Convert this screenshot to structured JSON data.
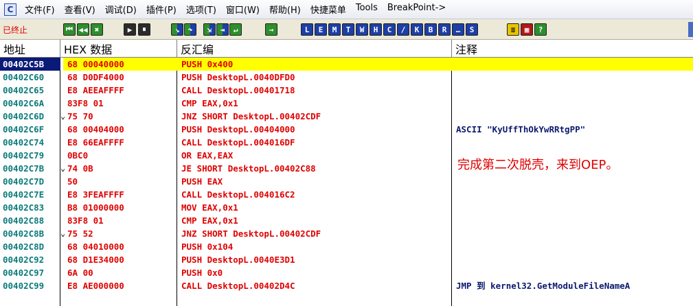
{
  "menu": {
    "app_icon_text": "C",
    "items": [
      "文件(F)",
      "查看(V)",
      "调试(D)",
      "插件(P)",
      "选项(T)",
      "窗口(W)",
      "帮助(H)",
      "快捷菜单",
      "Tools",
      "BreakPoint->"
    ]
  },
  "toolbar": {
    "status": "已终止",
    "status_color": "#e00000",
    "buttons": [
      {
        "label": "⏮",
        "icon": "restart-icon"
      },
      {
        "label": "◀◀",
        "icon": "rewind-icon"
      },
      {
        "label": "✖",
        "icon": "close-icon"
      },
      {
        "label": "▶",
        "icon": "run-icon"
      },
      {
        "label": "⏸",
        "icon": "pause-icon"
      },
      {
        "label": "↘",
        "icon": "step-into-icon"
      },
      {
        "label": "↷",
        "icon": "step-over-icon"
      },
      {
        "label": "⇲",
        "icon": "trace-into-icon"
      },
      {
        "label": "⇥",
        "icon": "trace-over-icon"
      },
      {
        "label": "↵",
        "icon": "execute-till-return-icon"
      },
      {
        "label": "→",
        "icon": "goto-icon"
      },
      {
        "label": "L",
        "icon": "log-window-icon"
      },
      {
        "label": "E",
        "icon": "executable-modules-icon"
      },
      {
        "label": "M",
        "icon": "memory-map-icon"
      },
      {
        "label": "T",
        "icon": "threads-icon"
      },
      {
        "label": "W",
        "icon": "windows-icon"
      },
      {
        "label": "H",
        "icon": "handles-icon"
      },
      {
        "label": "C",
        "icon": "cpu-icon"
      },
      {
        "label": "/",
        "icon": "patches-icon"
      },
      {
        "label": "K",
        "icon": "call-stack-icon"
      },
      {
        "label": "B",
        "icon": "breakpoints-icon"
      },
      {
        "label": "R",
        "icon": "references-icon"
      },
      {
        "label": "…",
        "icon": "run-trace-icon"
      },
      {
        "label": "S",
        "icon": "source-icon"
      },
      {
        "label": "≡",
        "icon": "appearance-icon"
      },
      {
        "label": "▦",
        "icon": "options-icon"
      },
      {
        "label": "?",
        "icon": "help-icon"
      }
    ]
  },
  "columns": {
    "address": "地址",
    "hex": "HEX 数据",
    "disasm": "反汇编",
    "comment": "注释"
  },
  "rows": [
    {
      "addr": "00402C5B",
      "jmp": "",
      "hex": "68 00040000",
      "asm": "PUSH 0x400",
      "comment": ""
    },
    {
      "addr": "00402C60",
      "jmp": "",
      "hex": "68 D0DF4000",
      "asm": "PUSH DesktopL.0040DFD0",
      "comment": ""
    },
    {
      "addr": "00402C65",
      "jmp": "",
      "hex": "E8 AEEAFFFF",
      "asm": "CALL DesktopL.00401718",
      "comment": ""
    },
    {
      "addr": "00402C6A",
      "jmp": "",
      "hex": "83F8 01",
      "asm": "CMP EAX,0x1",
      "comment": ""
    },
    {
      "addr": "00402C6D",
      "jmp": "⌄",
      "hex": "75 70",
      "asm": "JNZ SHORT DesktopL.00402CDF",
      "comment": ""
    },
    {
      "addr": "00402C6F",
      "jmp": "",
      "hex": "68 00404000",
      "asm": "PUSH DesktopL.00404000",
      "comment": "ASCII \"KyUffThOkYwRRtgPP\""
    },
    {
      "addr": "00402C74",
      "jmp": "",
      "hex": "E8 66EAFFFF",
      "asm": "CALL DesktopL.004016DF",
      "comment": ""
    },
    {
      "addr": "00402C79",
      "jmp": "",
      "hex": "0BC0",
      "asm": "OR EAX,EAX",
      "comment": ""
    },
    {
      "addr": "00402C7B",
      "jmp": "⌄",
      "hex": "74 0B",
      "asm": "JE SHORT DesktopL.00402C88",
      "comment": ""
    },
    {
      "addr": "00402C7D",
      "jmp": "",
      "hex": "50",
      "asm": "PUSH EAX",
      "comment": ""
    },
    {
      "addr": "00402C7E",
      "jmp": "",
      "hex": "E8 3FEAFFFF",
      "asm": "CALL DesktopL.004016C2",
      "comment": ""
    },
    {
      "addr": "00402C83",
      "jmp": "",
      "hex": "B8 01000000",
      "asm": "MOV EAX,0x1",
      "comment": ""
    },
    {
      "addr": "00402C88",
      "jmp": "",
      "hex": "83F8 01",
      "asm": "CMP EAX,0x1",
      "comment": ""
    },
    {
      "addr": "00402C8B",
      "jmp": "⌄",
      "hex": "75 52",
      "asm": "JNZ SHORT DesktopL.00402CDF",
      "comment": ""
    },
    {
      "addr": "00402C8D",
      "jmp": "",
      "hex": "68 04010000",
      "asm": "PUSH 0x104",
      "comment": ""
    },
    {
      "addr": "00402C92",
      "jmp": "",
      "hex": "68 D1E34000",
      "asm": "PUSH DesktopL.0040E3D1",
      "comment": ""
    },
    {
      "addr": "00402C97",
      "jmp": "",
      "hex": "6A 00",
      "asm": "PUSH 0x0",
      "comment": ""
    },
    {
      "addr": "00402C99",
      "jmp": "",
      "hex": "E8 AE000000",
      "asm": "CALL DesktopL.00402D4C",
      "comment": "JMP 到 kernel32.GetModuleFileNameA"
    }
  ],
  "selected_row": 0,
  "annotation": "完成第二次脱壳，来到OEP。",
  "colors": {
    "address": "#0a7a7a",
    "code": "#e00000",
    "comment": "#0c1a6e",
    "selection_addr_bg": "#0a1a78",
    "selection_band": "#ffff00"
  }
}
